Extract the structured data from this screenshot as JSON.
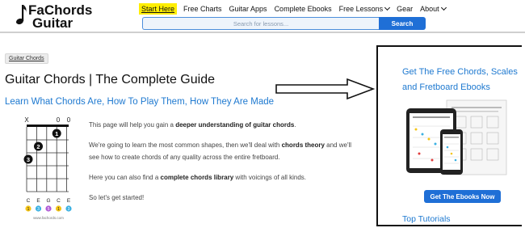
{
  "logo": {
    "line1": "FaChords",
    "line2": "Guitar"
  },
  "nav": {
    "items": [
      {
        "label": "Start Here",
        "highlight": true,
        "has_caret": false
      },
      {
        "label": "Free Charts",
        "highlight": false,
        "has_caret": false
      },
      {
        "label": "Guitar Apps",
        "highlight": false,
        "has_caret": false
      },
      {
        "label": "Complete Ebooks",
        "highlight": false,
        "has_caret": false
      },
      {
        "label": "Free Lessons",
        "highlight": false,
        "has_caret": true
      },
      {
        "label": "Gear",
        "highlight": false,
        "has_caret": false
      },
      {
        "label": "About",
        "highlight": false,
        "has_caret": true
      }
    ]
  },
  "search": {
    "placeholder": "Search for lessons...",
    "button_label": "Search"
  },
  "breadcrumb": "Guitar Chords",
  "page_title": "Guitar Chords | The Complete Guide",
  "subtitle": "Learn What Chords Are, How To Play Them, How They Are Made",
  "chord_diagram": {
    "top_markers": [
      "X",
      "0",
      "0"
    ],
    "finger_numbers": [
      "1",
      "2",
      "3"
    ],
    "string_notes": [
      "C",
      "E",
      "G",
      "C",
      "E"
    ],
    "intervals": [
      "1",
      "3",
      "5",
      "1",
      "3"
    ],
    "credit": "www.fachords.com",
    "colors": {
      "root": "#f5c518",
      "third": "#3ab0e2",
      "fifth": "#b05ad6"
    }
  },
  "intro": {
    "p1": {
      "before": "This page will help you gain a ",
      "bold": "deeper understanding of guitar chords",
      "after": "."
    },
    "p2": {
      "before": "We're going to learn the most common shapes, then we'll deal with ",
      "bold": "chords theory",
      "after": " and we'll see how to create chords of any quality across the entire fretboard."
    },
    "p3": {
      "before": "Here you can also find a ",
      "bold": "complete chords library",
      "after": " with voicings of all kinds."
    },
    "p4": "So let's get started!"
  },
  "sidebar": {
    "title_line1": "Get The Free Chords, Scales",
    "title_line2": "and Fretboard Ebooks",
    "button_label": "Get The Ebooks Now",
    "heading": "Top Tutorials"
  },
  "colors": {
    "accent_blue": "#1e79d0",
    "button_blue": "#1f6fd6",
    "highlight_yellow": "#ffee00"
  }
}
